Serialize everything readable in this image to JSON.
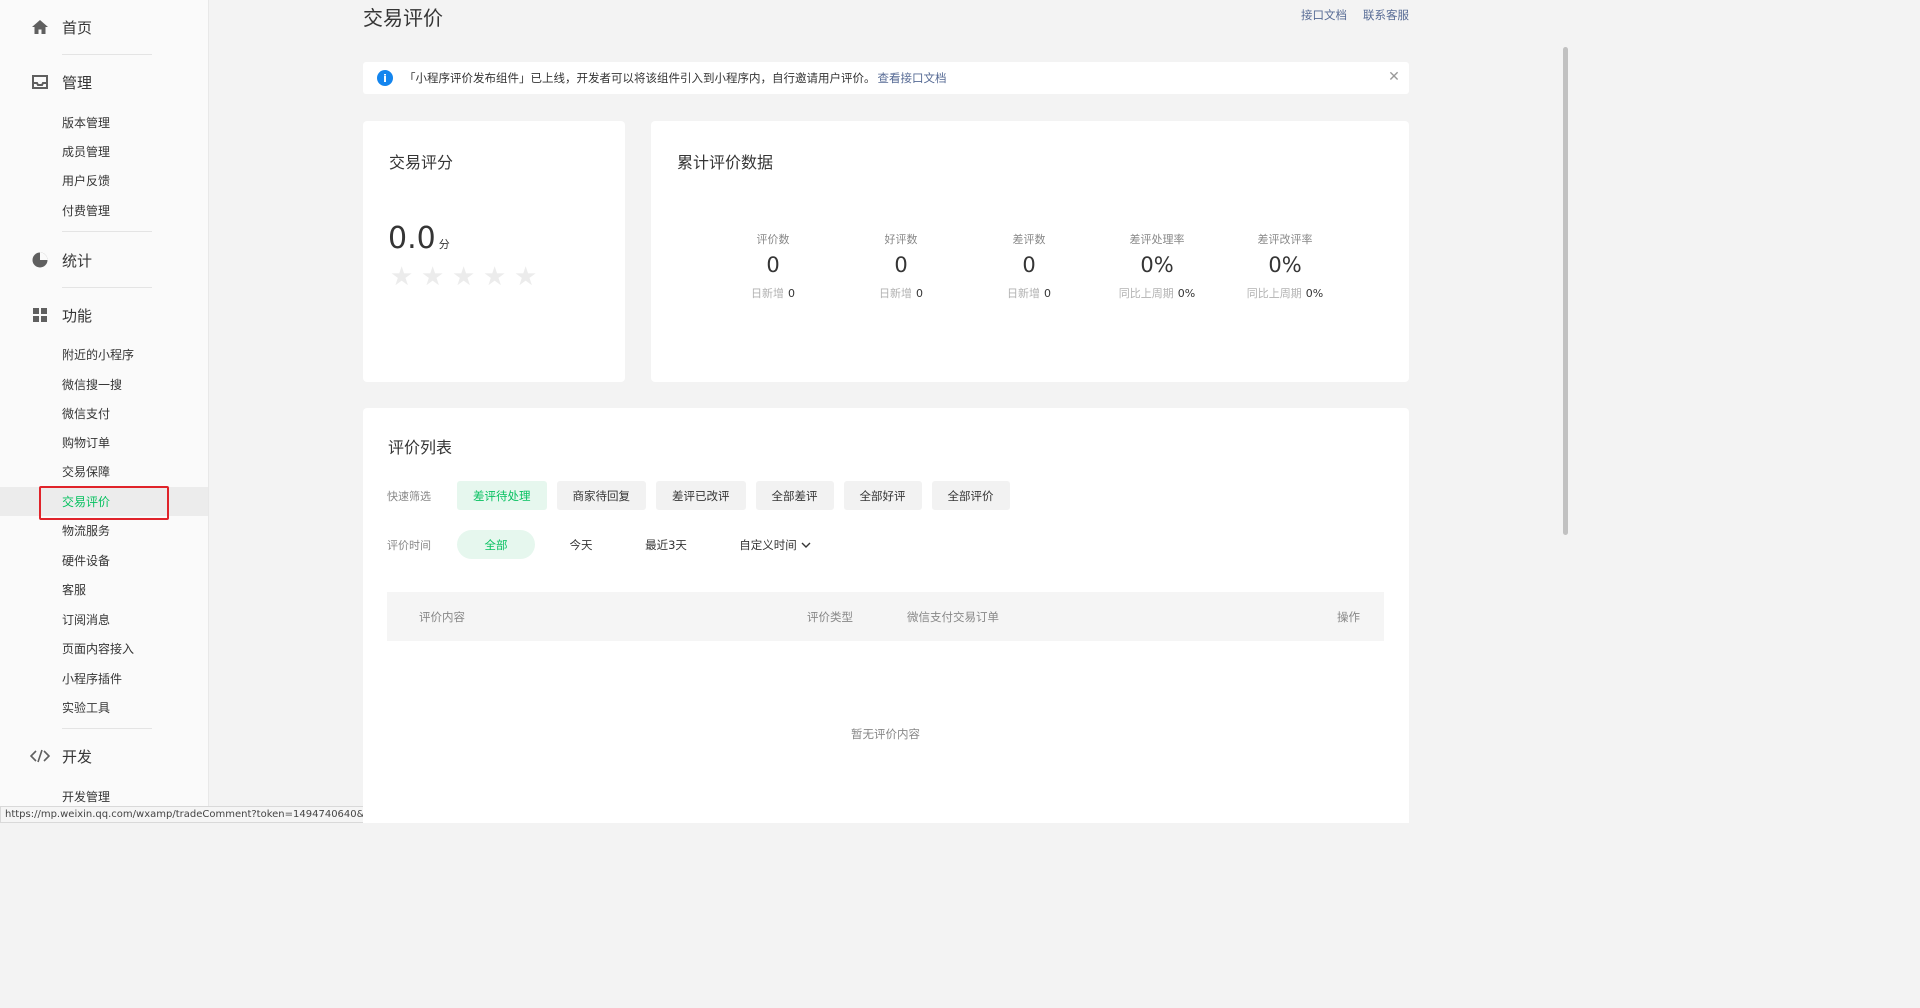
{
  "sidebar": {
    "home": "首页",
    "manage": "管理",
    "manage_items": [
      "版本管理",
      "成员管理",
      "用户反馈",
      "付费管理"
    ],
    "stats": "统计",
    "features": "功能",
    "feature_items": [
      "附近的小程序",
      "微信搜一搜",
      "微信支付",
      "购物订单",
      "交易保障",
      "交易评价",
      "物流服务",
      "硬件设备",
      "客服",
      "订阅消息",
      "页面内容接入",
      "小程序插件",
      "实验工具"
    ],
    "active_item": "交易评价",
    "dev": "开发",
    "dev_items": [
      "开发管理"
    ]
  },
  "header": {
    "title": "交易评价",
    "links": [
      "接口文档",
      "联系客服"
    ]
  },
  "notice": {
    "text": "「小程序评价发布组件」已上线，开发者可以将该组件引入到小程序内，自行邀请用户评价。",
    "link": "查看接口文档"
  },
  "score_card": {
    "title": "交易评分",
    "value": "0.0",
    "unit": "分",
    "stars_filled": 0,
    "stars_total": 5
  },
  "stats_card": {
    "title": "累计评价数据",
    "items": [
      {
        "label": "评价数",
        "value": "0",
        "sub_label": "日新增",
        "sub_value": "0"
      },
      {
        "label": "好评数",
        "value": "0",
        "sub_label": "日新增",
        "sub_value": "0"
      },
      {
        "label": "差评数",
        "value": "0",
        "sub_label": "日新增",
        "sub_value": "0"
      },
      {
        "label": "差评处理率",
        "value": "0%",
        "sub_label": "同比上周期",
        "sub_value": "0%"
      },
      {
        "label": "差评改评率",
        "value": "0%",
        "sub_label": "同比上周期",
        "sub_value": "0%"
      }
    ]
  },
  "list": {
    "title": "评价列表",
    "quick_filter_label": "快速筛选",
    "quick_filters": [
      "差评待处理",
      "商家待回复",
      "差评已改评",
      "全部差评",
      "全部好评",
      "全部评价"
    ],
    "quick_filter_active": "差评待处理",
    "time_label": "评价时间",
    "time_filters": [
      "全部",
      "今天",
      "最近3天",
      "自定义时间"
    ],
    "time_filter_active": "全部",
    "columns": [
      "评价内容",
      "评价类型",
      "微信支付交易订单",
      "操作"
    ],
    "empty_text": "暂无评价内容"
  },
  "status_url": "https://mp.weixin.qq.com/wxamp/tradeComment?token=1494740640&lang=zh_CN",
  "colors": {
    "accent": "#07c160",
    "link": "#576b95",
    "info": "#1485ee",
    "highlight": "#e0232a"
  }
}
